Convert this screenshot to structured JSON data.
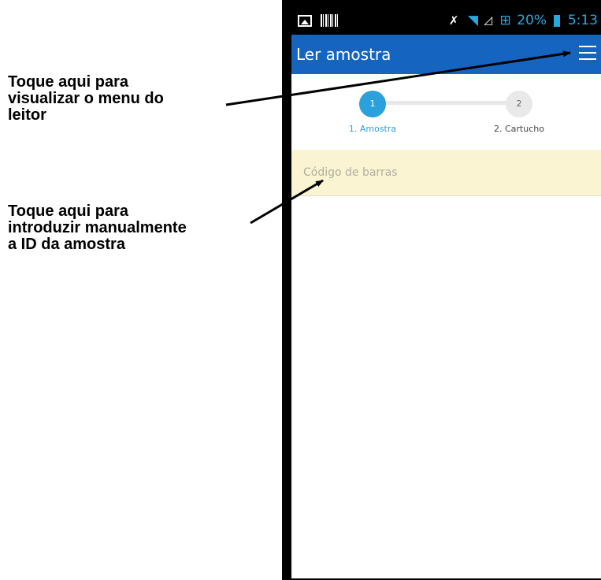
{
  "callouts": {
    "menu": "Toque aqui para\nvisualizar o menu do\nleitor",
    "sample_id": "Toque aqui para\nintroduzir manualmente\na ID da amostra"
  },
  "statusbar": {
    "battery": "20%",
    "time": "5:13"
  },
  "appbar": {
    "title": "Ler amostra"
  },
  "stepper": {
    "steps": [
      {
        "number": "1",
        "label": "1. Amostra",
        "active": true
      },
      {
        "number": "2",
        "label": "2. Cartucho",
        "active": false
      }
    ]
  },
  "barcode": {
    "placeholder": "Código de barras"
  },
  "colors": {
    "appbar": "#1565c0",
    "accent": "#2aa0dc",
    "barcode_bg": "#fbf4d3"
  }
}
